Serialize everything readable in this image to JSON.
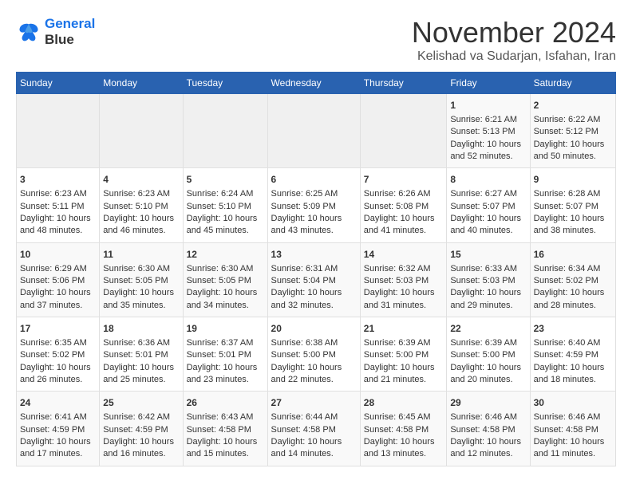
{
  "header": {
    "logo_line1": "General",
    "logo_line2": "Blue",
    "title": "November 2024",
    "subtitle": "Kelishad va Sudarjan, Isfahan, Iran"
  },
  "weekdays": [
    "Sunday",
    "Monday",
    "Tuesday",
    "Wednesday",
    "Thursday",
    "Friday",
    "Saturday"
  ],
  "weeks": [
    [
      {
        "day": "",
        "content": ""
      },
      {
        "day": "",
        "content": ""
      },
      {
        "day": "",
        "content": ""
      },
      {
        "day": "",
        "content": ""
      },
      {
        "day": "",
        "content": ""
      },
      {
        "day": "1",
        "content": "Sunrise: 6:21 AM\nSunset: 5:13 PM\nDaylight: 10 hours and 52 minutes."
      },
      {
        "day": "2",
        "content": "Sunrise: 6:22 AM\nSunset: 5:12 PM\nDaylight: 10 hours and 50 minutes."
      }
    ],
    [
      {
        "day": "3",
        "content": "Sunrise: 6:23 AM\nSunset: 5:11 PM\nDaylight: 10 hours and 48 minutes."
      },
      {
        "day": "4",
        "content": "Sunrise: 6:23 AM\nSunset: 5:10 PM\nDaylight: 10 hours and 46 minutes."
      },
      {
        "day": "5",
        "content": "Sunrise: 6:24 AM\nSunset: 5:10 PM\nDaylight: 10 hours and 45 minutes."
      },
      {
        "day": "6",
        "content": "Sunrise: 6:25 AM\nSunset: 5:09 PM\nDaylight: 10 hours and 43 minutes."
      },
      {
        "day": "7",
        "content": "Sunrise: 6:26 AM\nSunset: 5:08 PM\nDaylight: 10 hours and 41 minutes."
      },
      {
        "day": "8",
        "content": "Sunrise: 6:27 AM\nSunset: 5:07 PM\nDaylight: 10 hours and 40 minutes."
      },
      {
        "day": "9",
        "content": "Sunrise: 6:28 AM\nSunset: 5:07 PM\nDaylight: 10 hours and 38 minutes."
      }
    ],
    [
      {
        "day": "10",
        "content": "Sunrise: 6:29 AM\nSunset: 5:06 PM\nDaylight: 10 hours and 37 minutes."
      },
      {
        "day": "11",
        "content": "Sunrise: 6:30 AM\nSunset: 5:05 PM\nDaylight: 10 hours and 35 minutes."
      },
      {
        "day": "12",
        "content": "Sunrise: 6:30 AM\nSunset: 5:05 PM\nDaylight: 10 hours and 34 minutes."
      },
      {
        "day": "13",
        "content": "Sunrise: 6:31 AM\nSunset: 5:04 PM\nDaylight: 10 hours and 32 minutes."
      },
      {
        "day": "14",
        "content": "Sunrise: 6:32 AM\nSunset: 5:03 PM\nDaylight: 10 hours and 31 minutes."
      },
      {
        "day": "15",
        "content": "Sunrise: 6:33 AM\nSunset: 5:03 PM\nDaylight: 10 hours and 29 minutes."
      },
      {
        "day": "16",
        "content": "Sunrise: 6:34 AM\nSunset: 5:02 PM\nDaylight: 10 hours and 28 minutes."
      }
    ],
    [
      {
        "day": "17",
        "content": "Sunrise: 6:35 AM\nSunset: 5:02 PM\nDaylight: 10 hours and 26 minutes."
      },
      {
        "day": "18",
        "content": "Sunrise: 6:36 AM\nSunset: 5:01 PM\nDaylight: 10 hours and 25 minutes."
      },
      {
        "day": "19",
        "content": "Sunrise: 6:37 AM\nSunset: 5:01 PM\nDaylight: 10 hours and 23 minutes."
      },
      {
        "day": "20",
        "content": "Sunrise: 6:38 AM\nSunset: 5:00 PM\nDaylight: 10 hours and 22 minutes."
      },
      {
        "day": "21",
        "content": "Sunrise: 6:39 AM\nSunset: 5:00 PM\nDaylight: 10 hours and 21 minutes."
      },
      {
        "day": "22",
        "content": "Sunrise: 6:39 AM\nSunset: 5:00 PM\nDaylight: 10 hours and 20 minutes."
      },
      {
        "day": "23",
        "content": "Sunrise: 6:40 AM\nSunset: 4:59 PM\nDaylight: 10 hours and 18 minutes."
      }
    ],
    [
      {
        "day": "24",
        "content": "Sunrise: 6:41 AM\nSunset: 4:59 PM\nDaylight: 10 hours and 17 minutes."
      },
      {
        "day": "25",
        "content": "Sunrise: 6:42 AM\nSunset: 4:59 PM\nDaylight: 10 hours and 16 minutes."
      },
      {
        "day": "26",
        "content": "Sunrise: 6:43 AM\nSunset: 4:58 PM\nDaylight: 10 hours and 15 minutes."
      },
      {
        "day": "27",
        "content": "Sunrise: 6:44 AM\nSunset: 4:58 PM\nDaylight: 10 hours and 14 minutes."
      },
      {
        "day": "28",
        "content": "Sunrise: 6:45 AM\nSunset: 4:58 PM\nDaylight: 10 hours and 13 minutes."
      },
      {
        "day": "29",
        "content": "Sunrise: 6:46 AM\nSunset: 4:58 PM\nDaylight: 10 hours and 12 minutes."
      },
      {
        "day": "30",
        "content": "Sunrise: 6:46 AM\nSunset: 4:58 PM\nDaylight: 10 hours and 11 minutes."
      }
    ]
  ]
}
